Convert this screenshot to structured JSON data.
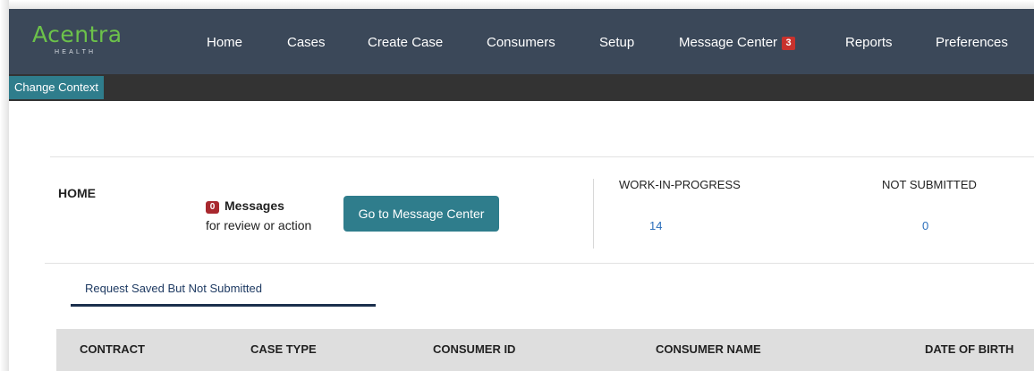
{
  "brand": {
    "name": "Acentra",
    "sub": "HEALTH",
    "color": "#6cc24a"
  },
  "nav": {
    "items": [
      {
        "id": "home",
        "label": "Home"
      },
      {
        "id": "cases",
        "label": "Cases"
      },
      {
        "id": "create-case",
        "label": "Create Case"
      },
      {
        "id": "consumers",
        "label": "Consumers"
      },
      {
        "id": "setup",
        "label": "Setup"
      },
      {
        "id": "message-center",
        "label": "Message Center",
        "badge": "3"
      },
      {
        "id": "reports",
        "label": "Reports"
      },
      {
        "id": "preferences",
        "label": "Preferences"
      }
    ]
  },
  "context": {
    "change_label": "Change Context"
  },
  "home": {
    "title": "HOME",
    "messages": {
      "count": "0",
      "label": "Messages",
      "sub": "for review or action"
    },
    "go_button": "Go to Message Center",
    "stats": [
      {
        "label": "WORK-IN-PROGRESS",
        "value": "14"
      },
      {
        "label": "NOT SUBMITTED",
        "value": "0"
      }
    ]
  },
  "tabs": [
    {
      "label": "Request Saved But Not Submitted",
      "active": true
    }
  ],
  "table": {
    "columns": [
      "CONTRACT",
      "CASE TYPE",
      "CONSUMER ID",
      "CONSUMER NAME",
      "DATE OF BIRTH"
    ]
  },
  "colors": {
    "nav_bg": "#3b4859",
    "accent": "#2f7d8c",
    "badge": "#c8322d",
    "link": "#2a6ebb"
  }
}
